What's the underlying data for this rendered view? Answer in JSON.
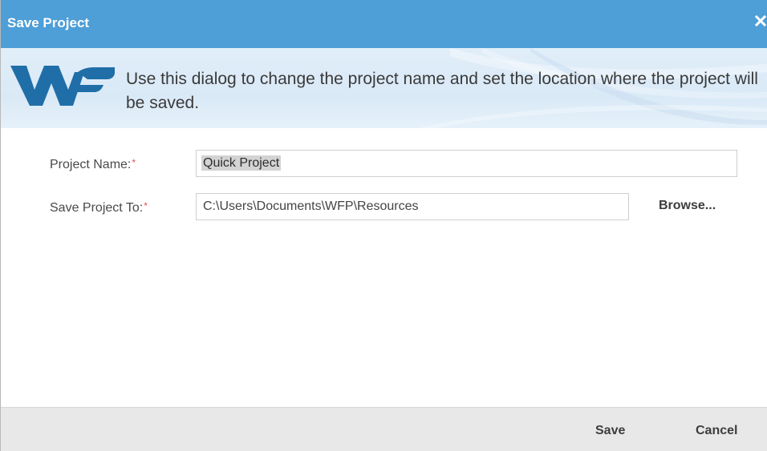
{
  "dialog": {
    "title": "Save Project",
    "close_icon": "close-icon",
    "banner_text": "Use this dialog to change the project name and set the location where the project will be saved.",
    "logo": "WF"
  },
  "form": {
    "project_name_label": "Project Name:",
    "project_name_value": "Quick Project",
    "save_to_label": "Save Project To:",
    "save_to_value": "C:\\Users\\Documents\\WFP\\Resources",
    "required_marker": "*",
    "browse_label": "Browse..."
  },
  "footer": {
    "save_label": "Save",
    "cancel_label": "Cancel"
  },
  "colors": {
    "title_bar": "#4e9ed7",
    "logo_blue": "#1f6ea8",
    "required": "#d9534f",
    "footer_bg": "#e8e8e8"
  }
}
